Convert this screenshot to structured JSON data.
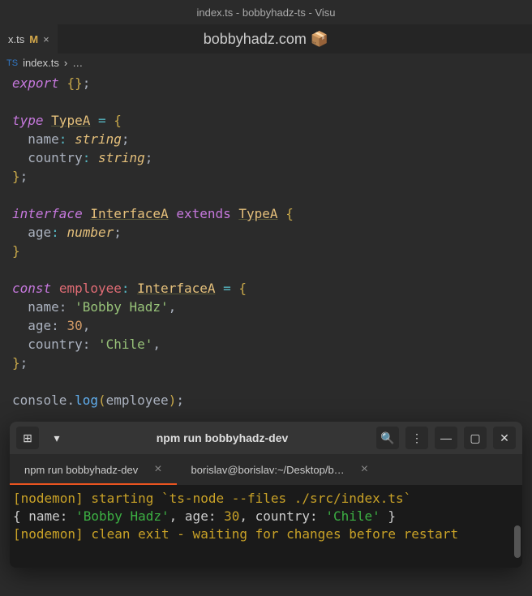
{
  "window": {
    "title": "index.ts - bobbyhadz-ts - Visu"
  },
  "tab": {
    "filename": "x.ts",
    "modified": "M",
    "close": "×"
  },
  "watermark": "bobbyhadz.com 📦",
  "breadcrumb": {
    "file": "index.ts",
    "sep": "›",
    "more": "…"
  },
  "code": {
    "l1_export": "export",
    "l1_braces": "{}",
    "l1_semi": ";",
    "l3_type": "type",
    "l3_name": "TypeA",
    "l3_eq": "=",
    "l3_open": "{",
    "l4_prop": "name",
    "l4_colon": ":",
    "l4_ptype": "string",
    "l4_semi": ";",
    "l5_prop": "country",
    "l5_colon": ":",
    "l5_ptype": "string",
    "l5_semi": ";",
    "l6_close": "}",
    "l6_semi": ";",
    "l8_interface": "interface",
    "l8_name": "InterfaceA",
    "l8_extends": "extends",
    "l8_ext": "TypeA",
    "l8_open": "{",
    "l9_prop": "age",
    "l9_colon": ":",
    "l9_ptype": "number",
    "l9_semi": ";",
    "l10_close": "}",
    "l12_const": "const",
    "l12_var": "employee",
    "l12_colon": ":",
    "l12_type": "InterfaceA",
    "l12_eq": "=",
    "l12_open": "{",
    "l13_prop": "name",
    "l13_val": "'Bobby Hadz'",
    "l13_comma": ",",
    "l14_prop": "age",
    "l14_val": "30",
    "l14_comma": ",",
    "l15_prop": "country",
    "l15_val": "'Chile'",
    "l15_comma": ",",
    "l16_close": "}",
    "l16_semi": ";",
    "l18_obj": "console",
    "l18_dot": ".",
    "l18_method": "log",
    "l18_open": "(",
    "l18_arg": "employee",
    "l18_close": ")",
    "l18_semi": ";"
  },
  "terminal": {
    "title": "npm run bobbyhadz-dev",
    "tabs": [
      {
        "label": "npm run bobbyhadz-dev"
      },
      {
        "label": "borislav@borislav:~/Desktop/b…"
      }
    ],
    "line1_pre": "[nodemon] starting ",
    "line1_cmd": "`ts-node --files ./src/index.ts`",
    "line2_a": "{ name: ",
    "line2_b": "'Bobby Hadz'",
    "line2_c": ", age: ",
    "line2_d": "30",
    "line2_e": ", country: ",
    "line2_f": "'Chile'",
    "line2_g": " }",
    "line3": "[nodemon] clean exit - waiting for changes before restart"
  }
}
